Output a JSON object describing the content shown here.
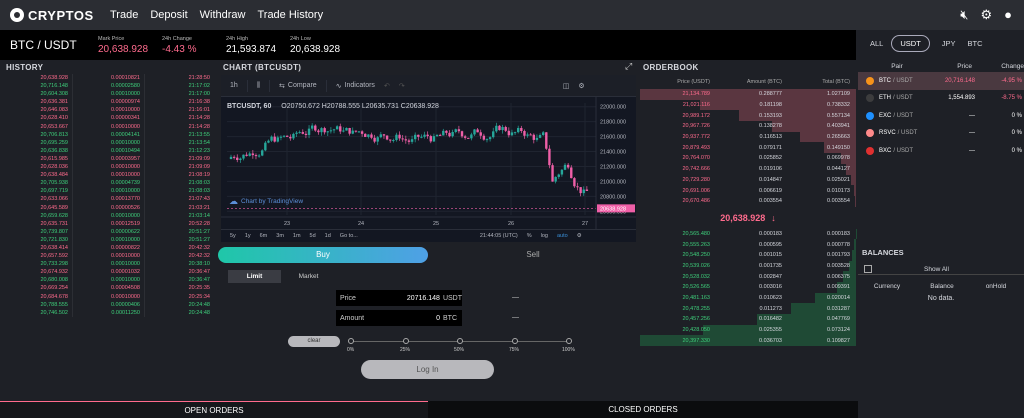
{
  "nav": {
    "logo": "CRYPTOS",
    "items": [
      "Trade",
      "Deposit",
      "Withdraw",
      "Trade History"
    ]
  },
  "ticker": {
    "pair": "BTC / USDT",
    "mark_label": "Mark Price",
    "mark_value": "20,638.928",
    "change_label": "24h Change",
    "change_value": "-4.43 %",
    "high_label": "24h High",
    "high_value": "21,593.874",
    "low_label": "24h Low",
    "low_value": "20,638.928"
  },
  "market_tabs": [
    "ALL",
    "USDT",
    "JPY",
    "BTC"
  ],
  "history": {
    "title": "HISTORY",
    "rows": [
      [
        "20,638.928",
        "0.00010821",
        "21:28:50",
        "red"
      ],
      [
        "20,716.148",
        "0.00002580",
        "21:17:02",
        "green"
      ],
      [
        "20,604.308",
        "0.00010000",
        "21:17:00",
        "green"
      ],
      [
        "20,636.381",
        "0.00000974",
        "21:16:38",
        "red"
      ],
      [
        "20,646.083",
        "0.00010000",
        "21:16:01",
        "red"
      ],
      [
        "20,628.410",
        "0.00000341",
        "21:14:28",
        "red"
      ],
      [
        "20,653.667",
        "0.00010000",
        "21:14:28",
        "red"
      ],
      [
        "20,706.813",
        "0.00004141",
        "21:13:55",
        "green"
      ],
      [
        "20,695.259",
        "0.00010000",
        "21:13:54",
        "green"
      ],
      [
        "20,636.838",
        "0.00010494",
        "21:12:23",
        "green"
      ],
      [
        "20,615.985",
        "0.00003957",
        "21:09:09",
        "red"
      ],
      [
        "20,628.036",
        "0.00010000",
        "21:09:09",
        "red"
      ],
      [
        "20,638.484",
        "0.00010000",
        "21:08:19",
        "red"
      ],
      [
        "20,705.938",
        "0.00004739",
        "21:08:03",
        "green"
      ],
      [
        "20,697.719",
        "0.00010000",
        "21:08:03",
        "green"
      ],
      [
        "20,633.066",
        "0.00013770",
        "21:07:43",
        "red"
      ],
      [
        "20,645.589",
        "0.00000526",
        "21:03:21",
        "red"
      ],
      [
        "20,659.628",
        "0.00010000",
        "21:03:14",
        "green"
      ],
      [
        "20,635.731",
        "0.00012519",
        "20:52:28",
        "red"
      ],
      [
        "20,739.807",
        "0.00000622",
        "20:51:27",
        "green"
      ],
      [
        "20,721.830",
        "0.00010000",
        "20:51:27",
        "green"
      ],
      [
        "20,638.414",
        "0.00000822",
        "20:42:32",
        "red"
      ],
      [
        "20,657.592",
        "0.00010000",
        "20:42:32",
        "red"
      ],
      [
        "20,733.298",
        "0.00010000",
        "20:38:10",
        "green"
      ],
      [
        "20,674.932",
        "0.00001032",
        "20:36:47",
        "red"
      ],
      [
        "20,680.008",
        "0.00010000",
        "20:36:47",
        "green"
      ],
      [
        "20,669.254",
        "0.00004508",
        "20:25:35",
        "red"
      ],
      [
        "20,684.678",
        "0.00010000",
        "20:25:34",
        "red"
      ],
      [
        "20,788.555",
        "0.00000406",
        "20:24:48",
        "green"
      ],
      [
        "20,746.502",
        "0.00011250",
        "20:24:48",
        "green"
      ]
    ]
  },
  "chart": {
    "title": "CHART (BTCUSDT)",
    "toolbar": [
      "1h",
      "Compare",
      "Indicators"
    ],
    "symbol": "BTCUSDT, 60",
    "ohlc": "O20750.672 H20788.555 L20635.731 C20638.928",
    "watermark": "Chart by TradingView",
    "ranges": [
      "5y",
      "1y",
      "6m",
      "3m",
      "1m",
      "5d",
      "1d",
      "Go to..."
    ],
    "time_readout": "21:44:05 (UTC)",
    "right_controls": [
      "%",
      "log",
      "auto"
    ],
    "current_price_label": "20638.928"
  },
  "chart_data": {
    "type": "candlestick",
    "x_ticks": [
      "23",
      "24",
      "25",
      "26",
      "27"
    ],
    "y_ticks": [
      "22000.000",
      "21800.000",
      "21600.000",
      "21400.000",
      "21200.000",
      "21000.000",
      "20800.000",
      "20600.000"
    ],
    "ylim": [
      20550,
      22050
    ],
    "last_price": 20638.928
  },
  "orderbook": {
    "title": "ORDERBOOK",
    "headers": [
      "Price (USDT)",
      "Amount (BTC)",
      "Total (BTC)"
    ],
    "asks": [
      [
        "21,134.789",
        "0.288777",
        "1.027109",
        1.0
      ],
      [
        "21,021.116",
        "0.181198",
        "0.738332",
        0.72
      ],
      [
        "20,989.172",
        "0.153193",
        "0.557134",
        0.54
      ],
      [
        "20,967.726",
        "0.138278",
        "0.403941",
        0.39
      ],
      [
        "20,937.772",
        "0.116513",
        "0.265663",
        0.26
      ],
      [
        "20,879.493",
        "0.079171",
        "0.149150",
        0.15
      ],
      [
        "20,764.070",
        "0.025852",
        "0.069978",
        0.07
      ],
      [
        "20,742.666",
        "0.019106",
        "0.044127",
        0.045
      ],
      [
        "20,729.280",
        "0.014847",
        "0.025021",
        0.025
      ],
      [
        "20,691.006",
        "0.006619",
        "0.010173",
        0.01
      ],
      [
        "20,670.486",
        "0.003554",
        "0.003554",
        0.004
      ]
    ],
    "mid_price": "20,638.928",
    "bids": [
      [
        "20,565.480",
        "0.000183",
        "0.000183",
        0.002
      ],
      [
        "20,555.263",
        "0.000595",
        "0.000778",
        0.008
      ],
      [
        "20,548.250",
        "0.001015",
        "0.001793",
        0.017
      ],
      [
        "20,539.026",
        "0.001735",
        "0.003528",
        0.034
      ],
      [
        "20,528.032",
        "0.002847",
        "0.006375",
        0.062
      ],
      [
        "20,526.565",
        "0.003016",
        "0.009391",
        0.09
      ],
      [
        "20,481.163",
        "0.010623",
        "0.020014",
        0.19
      ],
      [
        "20,478.255",
        "0.011273",
        "0.031287",
        0.3
      ],
      [
        "20,457.256",
        "0.016482",
        "0.047769",
        0.46
      ],
      [
        "20,428.050",
        "0.025355",
        "0.073124",
        0.71
      ],
      [
        "20,397.330",
        "0.036703",
        "0.109827",
        1.0
      ]
    ]
  },
  "markets": {
    "headers": [
      "Pair",
      "Price",
      "Change"
    ],
    "rows": [
      {
        "base": "BTC",
        "quote": "/ USDT",
        "price": "20,716.148",
        "change": "-4.95 %",
        "color": "#f7931a",
        "sel": true,
        "chg_red": true
      },
      {
        "base": "ETH",
        "quote": "/ USDT",
        "price": "1,554.893",
        "change": "-8.75 %",
        "color": "#3c3c3d",
        "sel": false,
        "chg_red": true
      },
      {
        "base": "EXC",
        "quote": "/ USDT",
        "price": "—",
        "change": "0 %",
        "color": "#1e90ff",
        "sel": false,
        "chg_red": false
      },
      {
        "base": "RSVC",
        "quote": "/ USDT",
        "price": "—",
        "change": "0 %",
        "color": "#ff8a8a",
        "sel": false,
        "chg_red": false
      },
      {
        "base": "BXC",
        "quote": "/ USDT",
        "price": "—",
        "change": "0 %",
        "color": "#e03030",
        "sel": false,
        "chg_red": false
      }
    ]
  },
  "balances": {
    "title": "BALANCES",
    "show_all": "Show All",
    "headers": [
      "Currency",
      "Balance",
      "onHold"
    ],
    "empty": "No data."
  },
  "trade": {
    "buy": "Buy",
    "sell": "Sell",
    "limit": "Limit",
    "market": "Market",
    "price_label": "Price",
    "price_value": "20716.148",
    "price_unit": "USDT",
    "amount_label": "Amount",
    "amount_value": "0",
    "amount_unit": "BTC",
    "dash": "—",
    "clear": "clear",
    "percents": [
      "0%",
      "25%",
      "50%",
      "75%",
      "100%"
    ],
    "login": "Log In"
  },
  "orders": {
    "open": "OPEN ORDERS",
    "closed": "CLOSED ORDERS"
  }
}
